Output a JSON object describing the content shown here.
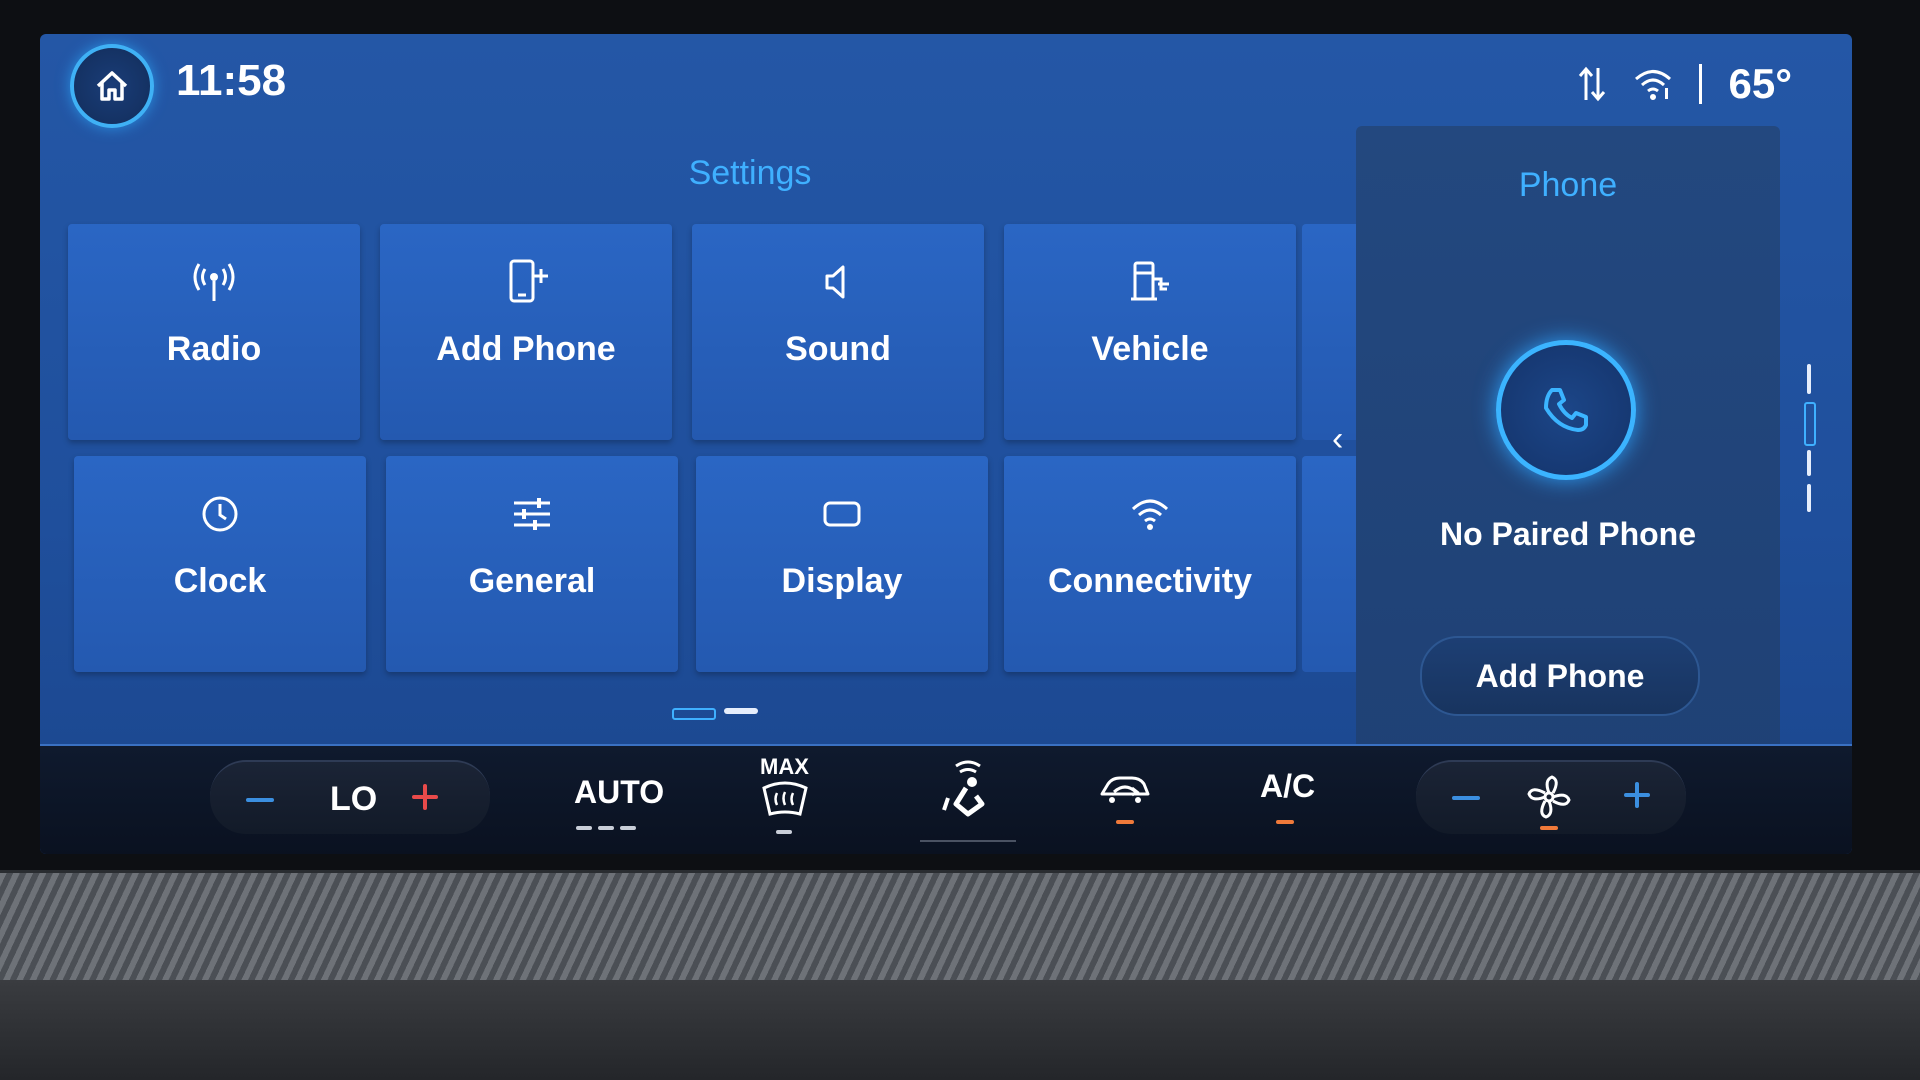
{
  "status": {
    "time": "11:58",
    "temperature": "65°"
  },
  "settings": {
    "title": "Settings",
    "tiles": [
      {
        "label": "Radio",
        "icon": "radio-icon"
      },
      {
        "label": "Add Phone",
        "icon": "add-phone-icon"
      },
      {
        "label": "Sound",
        "icon": "speaker-icon"
      },
      {
        "label": "Vehicle",
        "icon": "vehicle-icon"
      },
      {
        "label": "Clock",
        "icon": "clock-icon"
      },
      {
        "label": "General",
        "icon": "sliders-icon"
      },
      {
        "label": "Display",
        "icon": "display-icon"
      },
      {
        "label": "Connectivity",
        "icon": "wifi-icon"
      }
    ],
    "page": {
      "current": 1,
      "total": 2
    }
  },
  "phone": {
    "title": "Phone",
    "status": "No Paired Phone",
    "add_button": "Add Phone"
  },
  "climate": {
    "temp_setting": "LO",
    "auto_label": "AUTO",
    "max_label": "MAX",
    "ac_label": "A/C"
  },
  "colors": {
    "accent": "#3fb0ff",
    "screen": "#2457a6",
    "tile": "#2a66c4",
    "plus_red": "#e84a4a",
    "plus_blue": "#3b8fe0",
    "indicator_orange": "#f07a3a"
  }
}
